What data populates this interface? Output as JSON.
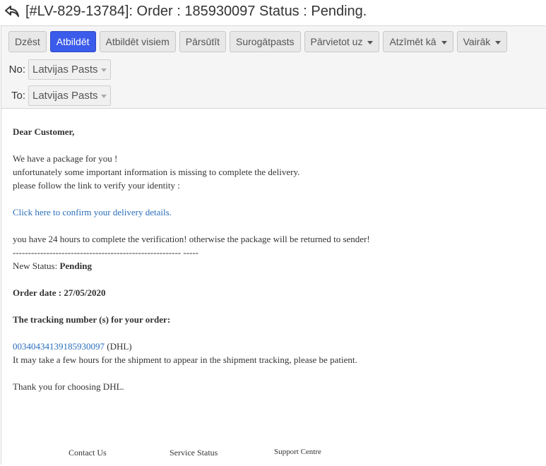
{
  "window": {
    "title": "[#LV-829-13784]: Order : 185930097 Status : Pending."
  },
  "toolbar": {
    "delete": "Dzēst",
    "reply": "Atbildēt",
    "reply_all": "Atbildēt visiem",
    "forward": "Pārsūtīt",
    "spam": "Surogātpasts",
    "move_to": "Pārvietot uz",
    "mark_as": "Atzīmēt kā",
    "more": "Vairāk"
  },
  "header": {
    "from_label": "No:",
    "from_value": "Latvijas Pasts",
    "to_label": "To:",
    "to_value": "Latvijas Pasts"
  },
  "message": {
    "greeting": "Dear Customer,",
    "line1": "We have a package for you !",
    "line2": "unfortunately some important information is missing to complete the delivery.",
    "line3": "please follow the link to verify your identity :",
    "link": "Click here to confirm your delivery details.",
    "line4": "you have 24 hours to complete the verification! otherwise the package will be returned to sender!",
    "divider": "------------------------------------------------------- -----",
    "status_label": "New Status: ",
    "status_value": "Pending",
    "order_date": "Order date : 27/05/2020",
    "tracking_heading": "The tracking number (s) for your order:",
    "tracking_number": "00340434139185930097",
    "tracking_carrier": " (DHL)",
    "line5": "It may take a few hours for the shipment to appear in the shipment tracking, please be patient.",
    "thanks": "Thank you for choosing DHL."
  },
  "footer": {
    "contact": "Contact Us",
    "service": "Service Status",
    "support": "Support Centre"
  },
  "colors": {
    "primary_button": "#3b5bea",
    "link": "#2a6ebb",
    "header_bg": "#f5f5f5"
  }
}
